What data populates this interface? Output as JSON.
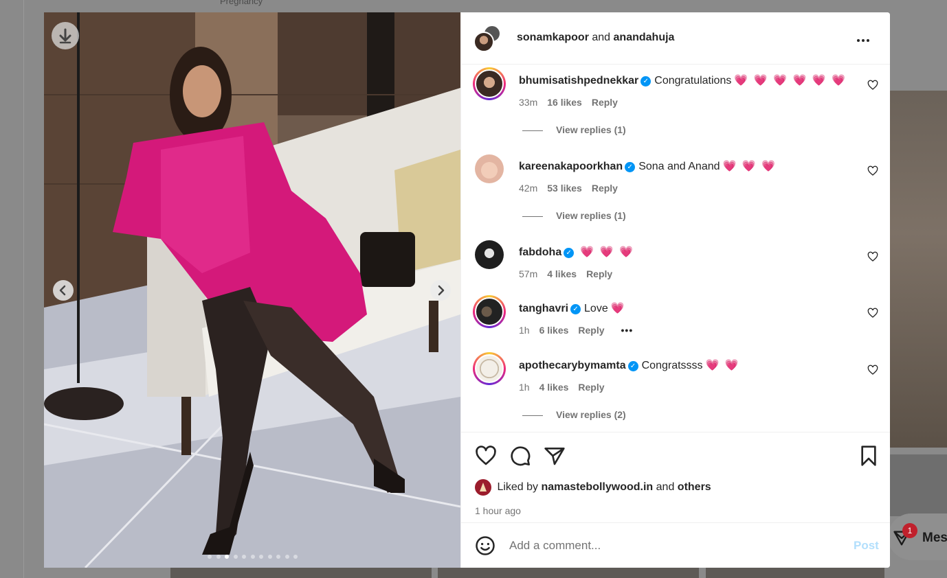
{
  "background": {
    "top_text": "Pregnancy",
    "messages": {
      "label": "Mes",
      "badge": "1"
    }
  },
  "header": {
    "user1": "sonamkapoor",
    "joiner": "and",
    "user2": "anandahuja"
  },
  "comments": [
    {
      "user": "bhumisatishpednekkar",
      "verified": true,
      "text": "Congratulations",
      "hearts": "💗 💗 💗 💗 💗 💗",
      "time": "33m",
      "likes": "16 likes",
      "reply": "Reply",
      "view_replies": "View replies (1)"
    },
    {
      "user": "kareenakapoorkhan",
      "verified": true,
      "text": "Sona and Anand",
      "hearts": "💗 💗 💗",
      "time": "42m",
      "likes": "53 likes",
      "reply": "Reply",
      "view_replies": "View replies (1)"
    },
    {
      "user": "fabdoha",
      "verified": true,
      "text": "",
      "hearts": "💗 💗 💗",
      "time": "57m",
      "likes": "4 likes",
      "reply": "Reply"
    },
    {
      "user": "tanghavri",
      "verified": true,
      "text": "Love",
      "hearts": "💗",
      "time": "1h",
      "likes": "6 likes",
      "reply": "Reply",
      "more": "•••"
    },
    {
      "user": "apothecarybymamta",
      "verified": true,
      "text": "Congratssss",
      "hearts": "💗 💗",
      "time": "1h",
      "likes": "4 likes",
      "reply": "Reply",
      "view_replies": "View replies (2)"
    }
  ],
  "likes": {
    "prefix": "Liked by",
    "user": "namastebollywood.in",
    "joiner": "and",
    "others": "others",
    "time_ago": "1 hour ago"
  },
  "add_comment": {
    "placeholder": "Add a comment...",
    "post": "Post"
  },
  "carousel": {
    "count": 11,
    "active": 2
  },
  "colors": {
    "accent": "#0095f6",
    "heart": "#f0336b",
    "post_disabled": "#b2dffc"
  }
}
